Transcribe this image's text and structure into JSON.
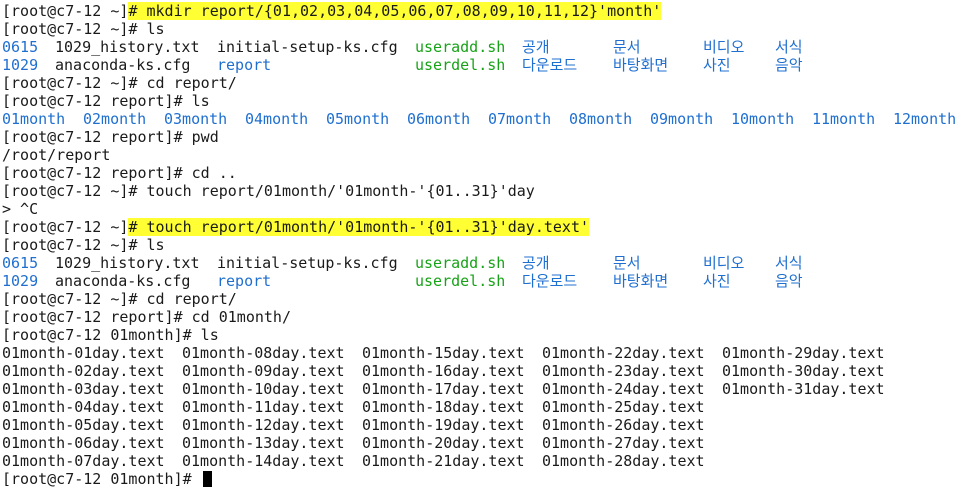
{
  "colors": {
    "background": "#ffffff",
    "text": "#1a1a1a",
    "directory": "#1f6fd0",
    "executable": "#17a317",
    "highlight": "#ffff33"
  },
  "lines": [
    {
      "prompt": "[root@c7-12 ~]",
      "cmd": "# mkdir report/{01,02,03,04,05,06,07,08,09,10,11,12}'month'"
    },
    {
      "prompt": "[root@c7-12 ~]",
      "cmd": "# ls"
    },
    {
      "ls_row": [
        "0615",
        "1029_history.txt",
        "initial-setup-ks.cfg",
        "useradd.sh",
        "공개",
        "문서",
        "비디오",
        "서식"
      ]
    },
    {
      "ls_row": [
        "1029",
        "anaconda-ks.cfg",
        "report",
        "userdel.sh",
        "다운로드",
        "바탕화면",
        "사진",
        "음악"
      ]
    },
    {
      "prompt": "[root@c7-12 ~]",
      "cmd": "# cd report/"
    },
    {
      "prompt": "[root@c7-12 report]",
      "cmd": "# ls"
    },
    {
      "months": [
        "01month",
        "02month",
        "03month",
        "04month",
        "05month",
        "06month",
        "07month",
        "08month",
        "09month",
        "10month",
        "11month",
        "12month"
      ]
    },
    {
      "prompt": "[root@c7-12 report]",
      "cmd": "# pwd"
    },
    {
      "text": "/root/report"
    },
    {
      "prompt": "[root@c7-12 report]",
      "cmd": "# cd .."
    },
    {
      "prompt": "[root@c7-12 ~]",
      "cmd": "# touch report/01month/'01month-'{01..31}'day"
    },
    {
      "text": "> ^C"
    },
    {
      "prompt": "[root@c7-12 ~]",
      "cmd": "# touch report/01month/'01month-'{01..31}'day.text'"
    },
    {
      "prompt": "[root@c7-12 ~]",
      "cmd": "# ls"
    },
    {
      "ls_row": [
        "0615",
        "1029_history.txt",
        "initial-setup-ks.cfg",
        "useradd.sh",
        "공개",
        "문서",
        "비디오",
        "서식"
      ]
    },
    {
      "ls_row": [
        "1029",
        "anaconda-ks.cfg",
        "report",
        "userdel.sh",
        "다운로드",
        "바탕화면",
        "사진",
        "음악"
      ]
    },
    {
      "prompt": "[root@c7-12 ~]",
      "cmd": "# cd report/"
    },
    {
      "prompt": "[root@c7-12 report]",
      "cmd": "# cd 01month/"
    },
    {
      "prompt": "[root@c7-12 01month]",
      "cmd": "# ls"
    },
    {
      "files": [
        "01month-01day.text",
        "01month-08day.text",
        "01month-15day.text",
        "01month-22day.text",
        "01month-29day.text"
      ]
    },
    {
      "files": [
        "01month-02day.text",
        "01month-09day.text",
        "01month-16day.text",
        "01month-23day.text",
        "01month-30day.text"
      ]
    },
    {
      "files": [
        "01month-03day.text",
        "01month-10day.text",
        "01month-17day.text",
        "01month-24day.text",
        "01month-31day.text"
      ]
    },
    {
      "files": [
        "01month-04day.text",
        "01month-11day.text",
        "01month-18day.text",
        "01month-25day.text"
      ]
    },
    {
      "files": [
        "01month-05day.text",
        "01month-12day.text",
        "01month-19day.text",
        "01month-26day.text"
      ]
    },
    {
      "files": [
        "01month-06day.text",
        "01month-13day.text",
        "01month-20day.text",
        "01month-27day.text"
      ]
    },
    {
      "files": [
        "01month-07day.text",
        "01month-14day.text",
        "01month-21day.text",
        "01month-28day.text"
      ]
    },
    {
      "prompt": "[root@c7-12 01month]",
      "cmd": "# "
    }
  ]
}
